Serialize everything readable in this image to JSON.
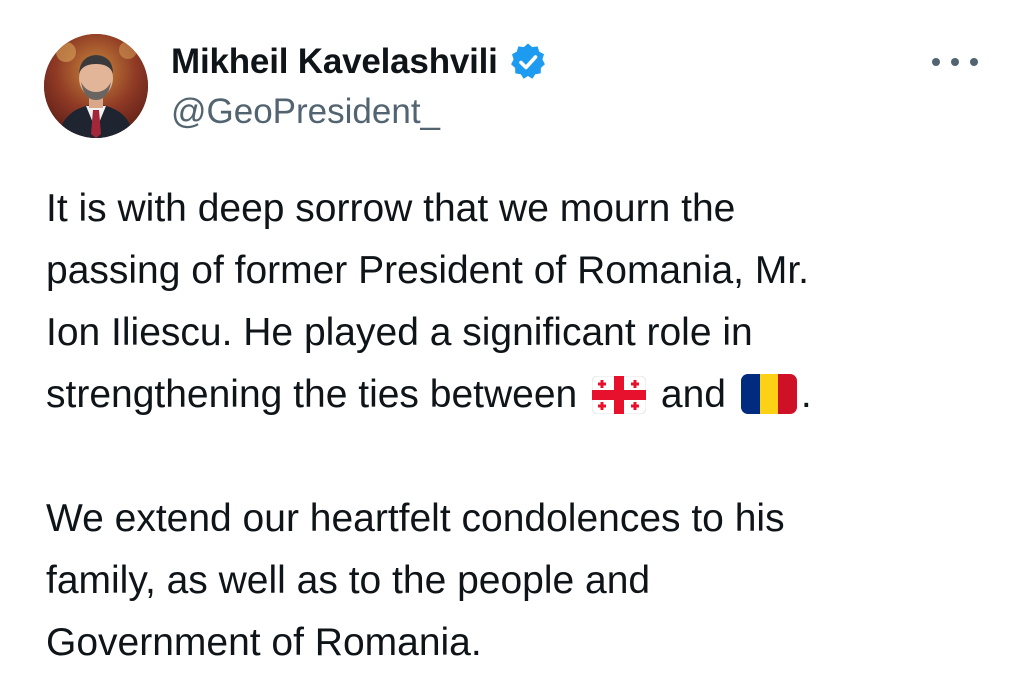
{
  "author": {
    "display_name": "Mikheil Kavelashvili",
    "handle": "@GeoPresident_",
    "verified": true,
    "verified_badge_color": "#1d9bf0",
    "avatar_icon": "profile-photo"
  },
  "menu": {
    "more_icon": "more-horizontal-icon"
  },
  "tweet": {
    "paragraph1": {
      "line1": "It is with deep sorrow that we mourn the",
      "line2": "passing of former President of Romania, Mr.",
      "line3": "Ion Iliescu. He played a significant role in",
      "line4_before": "strengthening the ties between",
      "line4_between": "and",
      "line4_end": "."
    },
    "paragraph2": {
      "line1": "We extend our heartfelt condolences to his",
      "line2": "family, as well as to the people and",
      "line3": "Government of Romania."
    },
    "flags": {
      "first": "georgia-flag",
      "second": "romania-flag"
    }
  },
  "colors": {
    "text": "#0f1419",
    "secondary": "#536471",
    "georgia_red": "#e8112d",
    "romania_blue": "#002b7f",
    "romania_yellow": "#fcd116",
    "romania_red": "#ce1126"
  }
}
